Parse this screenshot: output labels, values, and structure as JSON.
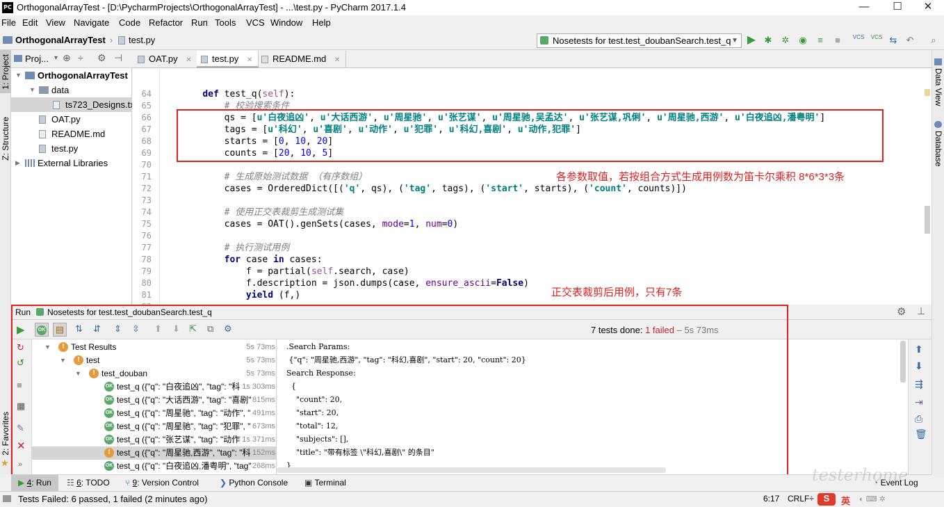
{
  "window": {
    "title": "OrthogonalArrayTest - [D:\\PycharmProjects\\OrthogonalArrayTest] - ...\\test.py - PyCharm 2017.1.4",
    "app_icon": "PC",
    "controls": [
      "—",
      "☐",
      "✕"
    ]
  },
  "menu": [
    "File",
    "Edit",
    "View",
    "Navigate",
    "Code",
    "Refactor",
    "Run",
    "Tools",
    "VCS",
    "Window",
    "Help"
  ],
  "nav": {
    "project": "OrthogonalArrayTest",
    "file": "test.py",
    "run_config": "Nosetests for test.test_doubanSearch.test_q",
    "vcs_labels": [
      "VCS",
      "VCS"
    ]
  },
  "left_strip": [
    "1: Project",
    "Z: Structure",
    "2: Favorites"
  ],
  "right_strip": [
    "Data View",
    "Database"
  ],
  "project_panel": {
    "header": "Proj...",
    "tree": [
      {
        "label": "OrthogonalArrayTest",
        "level": 0,
        "kind": "folder",
        "bold": true
      },
      {
        "label": "data",
        "level": 1,
        "kind": "folder"
      },
      {
        "label": "ts723_Designs.txt",
        "level": 2,
        "kind": "file",
        "selected": true
      },
      {
        "label": "OAT.py",
        "level": 1,
        "kind": "py"
      },
      {
        "label": "README.md",
        "level": 1,
        "kind": "md"
      },
      {
        "label": "test.py",
        "level": 1,
        "kind": "py"
      },
      {
        "label": "External Libraries",
        "level": 0,
        "kind": "lib"
      }
    ]
  },
  "tabs": [
    {
      "label": "OAT.py",
      "active": false
    },
    {
      "label": "test.py",
      "active": true
    },
    {
      "label": "README.md",
      "active": false
    }
  ],
  "editor": {
    "line_numbers": [
      "64",
      "65",
      "66",
      "67",
      "68",
      "69",
      "70",
      "71",
      "72",
      "73",
      "74",
      "75",
      "76",
      "77",
      "78",
      "79",
      "80",
      "81",
      "82"
    ],
    "lines": [
      "    def test_q(self):",
      "        # 校验搜索条件",
      "        qs = [u'白夜追凶', u'大话西游', u'周星驰', u'张艺谋', u'周星驰,吴孟达', u'张艺谋,巩俐', u'周星驰,西游', u'白夜追凶,潘粤明']",
      "        tags = [u'科幻', u'喜剧', u'动作', u'犯罪', u'科幻,喜剧', u'动作,犯罪']",
      "        starts = [0, 10, 20]",
      "        counts = [20, 10, 5]",
      "",
      "        # 生成原始测试数据 （有序数组）",
      "        cases = OrderedDict([('q', qs), ('tag', tags), ('start', starts), ('count', counts)])",
      "",
      "        # 使用正交表裁剪生成测试集",
      "        cases = OAT().genSets(cases, mode=1, num=0)",
      "",
      "        # 执行测试用例",
      "        for case in cases:",
      "            f = partial(self.search, case)",
      "            f.description = json.dumps(case, ensure_ascii=False)",
      "            yield (f,)",
      ""
    ],
    "annotation_1": "各参数取值，若按组合方式生成用例数为笛卡尔乘积  8*6*3*3条",
    "annotation_2": "正交表裁剪后用例，只有7条"
  },
  "run": {
    "label": "Run",
    "config": "Nosetests for test.test_doubanSearch.test_q",
    "summary_prefix": "7 tests done: ",
    "summary_failed": "1 failed",
    "summary_suffix": " – 5s 73ms",
    "progress_failed": 1,
    "progress_total": 7,
    "tree": [
      {
        "label": "Test Results",
        "time": "5s 73ms",
        "status": "warn",
        "level": 0
      },
      {
        "label": "test",
        "time": "5s 73ms",
        "status": "warn",
        "level": 1
      },
      {
        "label": "test_douban",
        "time": "5s 73ms",
        "status": "warn",
        "level": 2
      },
      {
        "label": "test_q ({\"q\": \"白夜追凶\", \"tag\": \"科幻",
        "time": "1s 303ms",
        "status": "ok",
        "level": 3
      },
      {
        "label": "test_q ({\"q\": \"大话西游\", \"tag\": \"喜剧\"",
        "time": "815ms",
        "status": "ok",
        "level": 3
      },
      {
        "label": "test_q ({\"q\": \"周星驰\", \"tag\": \"动作\", \"s",
        "time": "491ms",
        "status": "ok",
        "level": 3
      },
      {
        "label": "test_q ({\"q\": \"周星驰\", \"tag\": \"犯罪\", \"s",
        "time": "673ms",
        "status": "ok",
        "level": 3
      },
      {
        "label": "test_q ({\"q\": \"张艺谋\", \"tag\": \"动作\", \"s",
        "time": "1s 371ms",
        "status": "ok",
        "level": 3
      },
      {
        "label": "test_q ({\"q\": \"周星驰,西游\", \"tag\": \"科幻",
        "time": "152ms",
        "status": "warn",
        "level": 3,
        "selected": true
      },
      {
        "label": "test_q ({\"q\": \"白夜追凶,潘粤明\", \"tag\":",
        "time": "268ms",
        "status": "ok",
        "level": 3
      }
    ],
    "console": [
      ".Search Params:",
      " {\"q\": \"周星驰,西游\", \"tag\": \"科幻,喜剧\", \"start\": 20, \"count\": 20}",
      "Search Response:",
      "  {",
      "    \"count\": 20,",
      "    \"start\": 20,",
      "    \"total\": 12,",
      "    \"subjects\": [],",
      "    \"title\": \"带有标签 \\\"科幻,喜剧\\\" 的条目\"",
      "}"
    ]
  },
  "bottom_tabs": [
    {
      "num": "4",
      "rest": ": Run"
    },
    {
      "num": "6",
      "rest": ": TODO"
    },
    {
      "num": "9",
      "rest": ": Version Control"
    },
    {
      "num": "",
      "rest": "Python Console"
    },
    {
      "num": "",
      "rest": "Terminal"
    }
  ],
  "event_log": "Event Log",
  "status": {
    "message": "Tests Failed: 6 passed, 1 failed (2 minutes ago)",
    "position": "6:17",
    "line_sep": "CRLF÷",
    "ime": "英",
    "watermark": "testerhome"
  },
  "colors": {
    "highlight_box": "#e0201f",
    "failed": "#c7222d",
    "ok": "#59a869",
    "warn": "#e39b3c"
  }
}
